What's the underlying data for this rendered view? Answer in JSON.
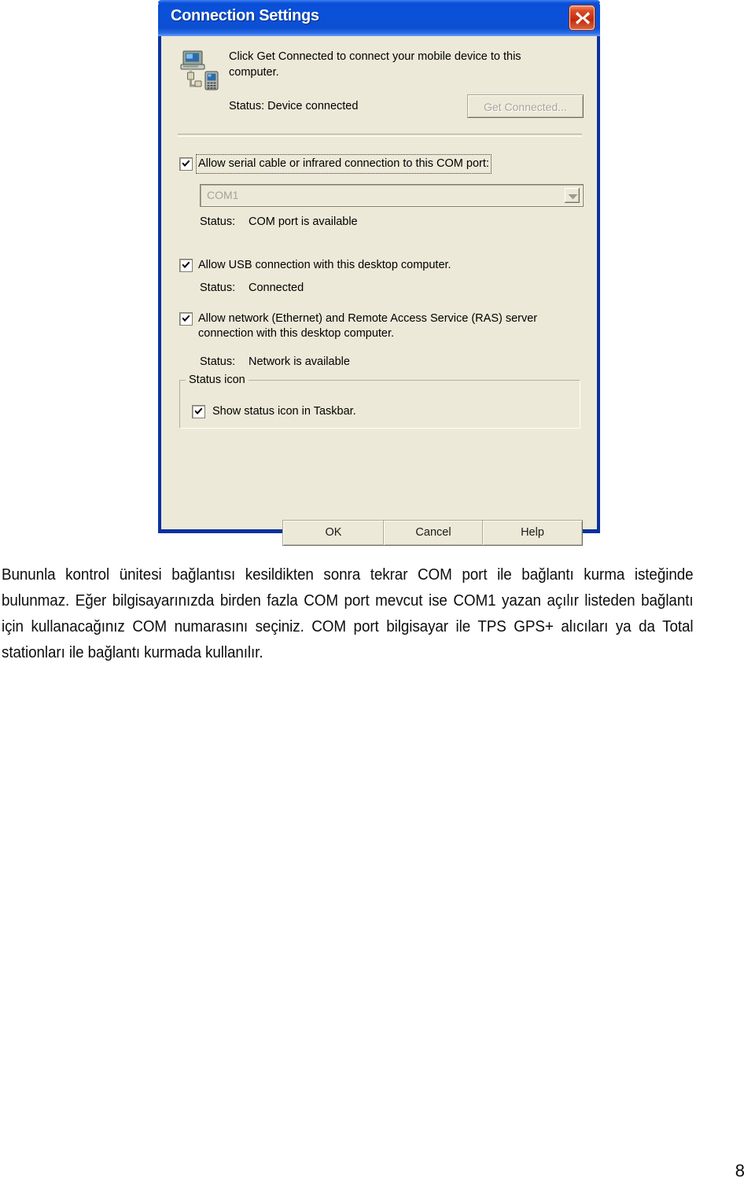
{
  "document": {
    "paragraph": "Bununla kontrol ünitesi bağlantısı kesildikten sonra tekrar COM port ile bağlantı kurma isteğinde bulunmaz. Eğer bilgisayarınızda birden fazla COM port mevcut ise COM1 yazan açılır listeden bağlantı için kullanacağınız COM numarasını seçiniz. COM port bilgisayar ile TPS GPS+ alıcıları ya da Total stationları ile bağlantı kurmada kullanılır.",
    "page_number": "8"
  },
  "dialog": {
    "title": "Connection Settings",
    "close_tooltip": "Close",
    "colors": {
      "titlebar": "#0A50D8",
      "client_background": "#ECE9D8",
      "close_button": "#C2290C",
      "frame": "#0831A0"
    },
    "device_icon_name": "pc-to-mobile-device-icon",
    "intro_text": "Click Get Connected to connect your mobile device to this computer.",
    "device_status": "Status: Device connected",
    "get_connected_button": "Get Connected...",
    "get_connected_enabled": false,
    "serial": {
      "checkbox_label": "Allow serial cable or infrared connection to this COM port:",
      "checked": true,
      "focused": true,
      "port_value": "COM1",
      "port_options": [
        "COM1"
      ],
      "port_enabled": false,
      "status_label": "Status:",
      "status_value": "COM port is available"
    },
    "usb": {
      "checkbox_label": "Allow USB connection with this desktop computer.",
      "checked": true,
      "status_label": "Status:",
      "status_value": "Connected"
    },
    "network": {
      "checkbox_label": "Allow network (Ethernet) and Remote Access Service (RAS) server connection with this desktop computer.",
      "checked": true,
      "status_label": "Status:",
      "status_value": "Network is available"
    },
    "status_icon_group": {
      "title": "Status icon",
      "checkbox_label": "Show status icon in Taskbar.",
      "checked": true
    },
    "buttons": {
      "ok": "OK",
      "cancel": "Cancel",
      "help": "Help"
    }
  }
}
